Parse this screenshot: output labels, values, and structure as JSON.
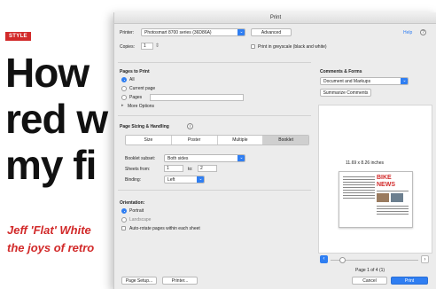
{
  "article": {
    "tag": "STYLE",
    "headline_lines": [
      "How",
      "red w",
      "my fi"
    ],
    "standfirst_lines": [
      "Jeff 'Flat' White",
      "the joys of retro"
    ]
  },
  "dialog": {
    "title": "Print",
    "printer_label": "Printer:",
    "printer_value": "Photosmart 8700 series (36D86A)",
    "advanced_button": "Advanced",
    "help_link": "Help",
    "copies_label": "Copies:",
    "copies_value": "1",
    "grayscale_label": "Print in greyscale (black and white)",
    "pages_section": {
      "title": "Pages to Print",
      "all": "All",
      "current": "Current page",
      "pages": "Pages",
      "more": "More Options"
    },
    "comments_section": {
      "title": "Comments & Forms",
      "value": "Document and Markups",
      "summarize_button": "Summarize Comments"
    },
    "sizing_section": {
      "title": "Page Sizing & Handling",
      "help": "i",
      "tabs": [
        "Size",
        "Poster",
        "Multiple",
        "Booklet"
      ],
      "selected_tab": "Booklet",
      "booklet_subset_label": "Booklet subset:",
      "booklet_subset_value": "Both sides",
      "sheets_label": "Sheets from:",
      "sheets_from": "1",
      "sheets_to_label": "to:",
      "sheets_to": "2",
      "binding_label": "Binding:",
      "binding_value": "Left"
    },
    "orientation_section": {
      "title": "Orientation:",
      "portrait": "Portrait",
      "landscape": "Landscape",
      "auto_rotate": "Auto-rotate pages within each sheet"
    },
    "preview": {
      "size_label": "11.69 x 8.26 inches",
      "thumb_title": "BIKE NEWS",
      "page_indicator": "Page 1 of 4 (1)",
      "prev": "‹",
      "next": "›"
    },
    "footer": {
      "page_setup": "Page Setup...",
      "printer_button": "Printer...",
      "cancel": "Cancel",
      "print": "Print"
    }
  }
}
